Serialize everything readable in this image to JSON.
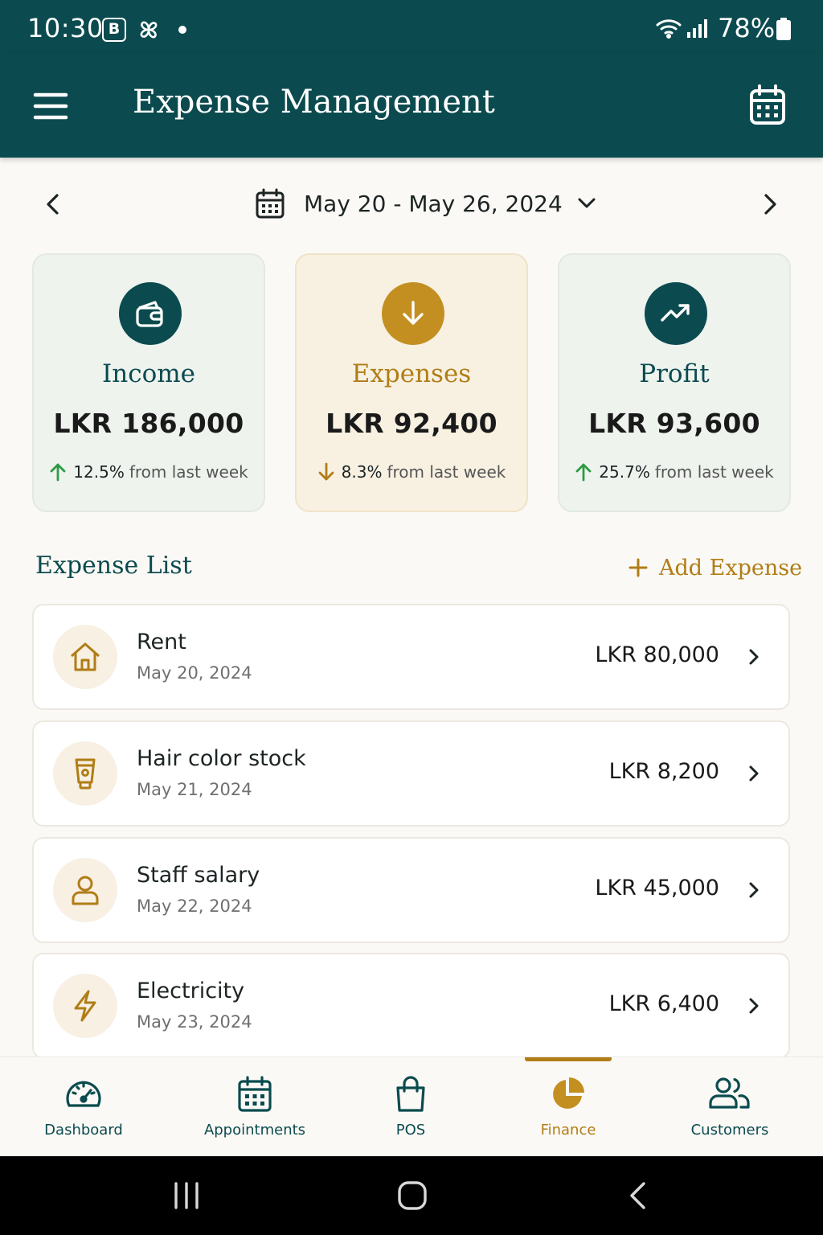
{
  "status_bar": {
    "time": "10:30",
    "badge": "B",
    "battery": "78%"
  },
  "app_bar": {
    "title": "Expense Management"
  },
  "date_range": {
    "label": "May 20 - May 26, 2024"
  },
  "summary": [
    {
      "key": "income",
      "label": "Income",
      "amount": "LKR 186,000",
      "change": "12.5%",
      "change_suffix": "from last week",
      "direction": "up"
    },
    {
      "key": "expenses",
      "label": "Expenses",
      "amount": "LKR 92,400",
      "change": "8.3%",
      "change_suffix": "from last week",
      "direction": "down"
    },
    {
      "key": "profit",
      "label": "Profit",
      "amount": "LKR 93,600",
      "change": "25.7%",
      "change_suffix": "from last week",
      "direction": "up"
    }
  ],
  "expense_list": {
    "title": "Expense List",
    "add_label": "Add Expense",
    "items": [
      {
        "name": "Rent",
        "date": "May 20, 2024",
        "amount": "LKR 80,000",
        "icon": "home-icon"
      },
      {
        "name": "Hair color stock",
        "date": "May 21, 2024",
        "amount": "LKR 8,200",
        "icon": "product-tube-icon"
      },
      {
        "name": "Staff salary",
        "date": "May 22, 2024",
        "amount": "LKR 45,000",
        "icon": "person-icon"
      },
      {
        "name": "Electricity",
        "date": "May 23, 2024",
        "amount": "LKR 6,400",
        "icon": "lightning-icon"
      }
    ]
  },
  "bottom_nav": {
    "items": [
      {
        "label": "Dashboard",
        "icon": "speedometer-icon"
      },
      {
        "label": "Appointments",
        "icon": "calendar-icon"
      },
      {
        "label": "POS",
        "icon": "shopping-bag-icon"
      },
      {
        "label": "Finance",
        "icon": "pie-chart-icon",
        "active": true
      },
      {
        "label": "Customers",
        "icon": "people-icon"
      }
    ]
  },
  "colors": {
    "primary": "#0b4b4f",
    "accent": "#b07d16",
    "background": "#fbf9f5",
    "positive": "#2e9a45"
  }
}
